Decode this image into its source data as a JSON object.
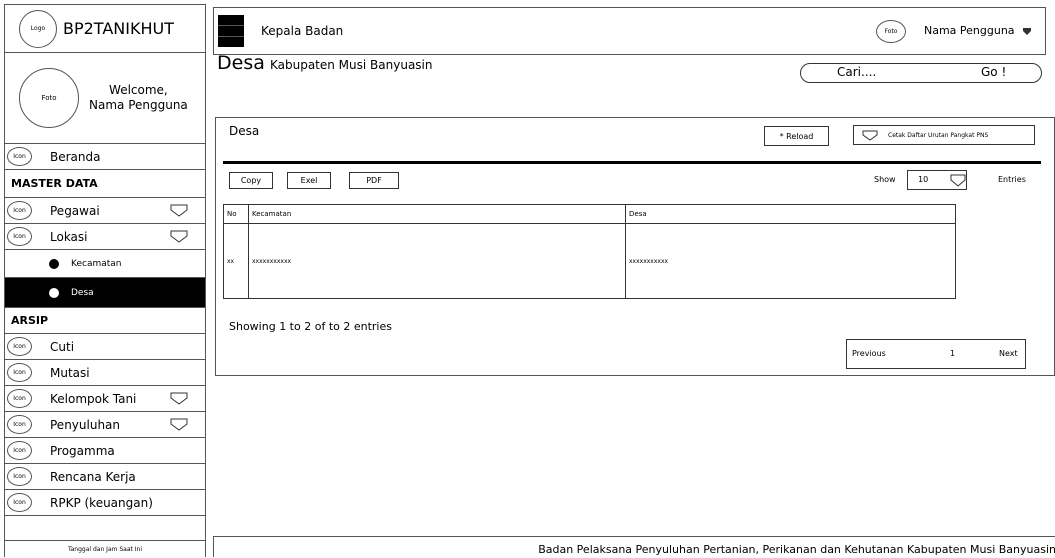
{
  "sidebar": {
    "logo_label": "Logo",
    "brand": "BP2TANIKHUT",
    "photo_label": "Foto",
    "welcome_line1": "Welcome,",
    "welcome_line2": "Nama Pengguna",
    "icon_label": "Icon",
    "beranda": "Beranda",
    "master_data": "MASTER DATA",
    "pegawai": "Pegawai",
    "lokasi": "Lokasi",
    "kecamatan": "Kecamatan",
    "desa": "Desa",
    "arsip": "ARSIP",
    "cuti": "Cuti",
    "mutasi": "Mutasi",
    "kelompok_tani": "Kelompok Tani",
    "penyuluhan": "Penyuluhan",
    "progamma": "Progamma",
    "rencana_kerja": "Rencana Kerja",
    "rpkp": "RPKP (keuangan)",
    "datetime": "Tanggal dan Jam Saat Ini"
  },
  "header": {
    "title": "Kepala Badan",
    "photo_label": "Foto",
    "user_name": "Nama Pengguna"
  },
  "page": {
    "title": "Desa",
    "subtitle": "Kabupaten Musi Banyuasin",
    "search_placeholder": "Cari....",
    "go_label": "Go !"
  },
  "panel": {
    "title": "Desa",
    "reload_label": "* Reload",
    "print_label": "Cetak Daftar Urutan Pangkat PNS",
    "copy_label": "Copy",
    "excel_label": "Exel",
    "pdf_label": "PDF",
    "show_label": "Show",
    "entries_value": "10",
    "entries_label": "Entries",
    "columns": [
      "No",
      "Kecamatan",
      "Desa"
    ],
    "rows": [
      [
        "xx",
        "xxxxxxxxxxx",
        "xxxxxxxxxxx"
      ]
    ],
    "info": "Showing 1 to 2 of to 2 entries",
    "prev_label": "Previous",
    "page_number": "1",
    "next_label": "Next"
  },
  "footer": {
    "text": "Badan Pelaksana Penyuluhan Pertanian, Perikanan dan Kehutanan Kabupaten Musi Banyuasin"
  }
}
